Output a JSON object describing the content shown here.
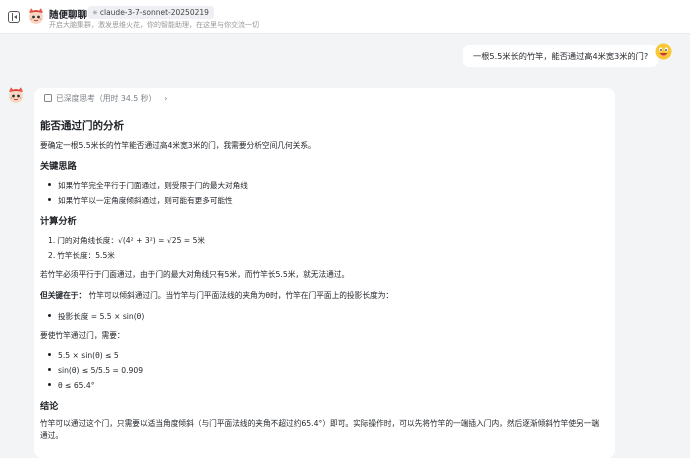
{
  "header": {
    "title": "随便聊聊",
    "model": "claude-3-7-sonnet-20250219",
    "subtitle": "开启大脑集群，激发思维火花，你的智能助理，在这里与你交流一切"
  },
  "conversation": {
    "user_message": "一根5.5米长的竹竿，能否通过高4米宽3米的门?",
    "thinking_label": "已深度思考（用时 34.5 秒）",
    "answer": {
      "h1": "能否通过门的分析",
      "intro": "要确定一根5.5米长的竹竿能否通过高4米宽3米的门，我需要分析空间几何关系。",
      "h2_idea": "关键思路",
      "idea_items": [
        "如果竹竿完全平行于门面通过，则受限于门的最大对角线",
        "如果竹竿以一定角度倾斜通过，则可能有更多可能性"
      ],
      "h2_calc": "计算分析",
      "calc_items": [
        {
          "num": "1.",
          "text": "门的对角线长度：√(4² + 3²) = √25 = 5米"
        },
        {
          "num": "2.",
          "text": "竹竿长度：5.5米"
        }
      ],
      "para_parallel": "若竹竿必须平行于门面通过，由于门的最大对角线只有5米，而竹竿长5.5米，就无法通过。",
      "para_key_bold": "但关键在于：",
      "para_key_rest": " 竹竿可以倾斜通过门。当竹竿与门平面法线的夹角为θ时，竹竿在门平面上的投影长度为：",
      "proj_item": "投影长度 = 5.5 × sin(θ)",
      "para_need": "要使竹竿通过门，需要：",
      "cond_items": [
        "5.5 × sin(θ) ≤ 5",
        "sin(θ) ≤ 5/5.5 = 0.909",
        "θ ≤ 65.4°"
      ],
      "h2_conclusion": "结论",
      "conclusion": "竹竿可以通过这个门，只需要以适当角度倾斜（与门平面法线的夹角不超过约65.4°）即可。实际操作时，可以先将竹竿的一端插入门内，然后逐渐倾斜竹竿使另一端通过。"
    }
  },
  "icons": {
    "sidebar": "sidebar-toggle-icon",
    "assistant": "cartoon-cat-avatar-icon",
    "user": "smiley-face-avatar-icon"
  },
  "colors": {
    "background": "#f3f4f6",
    "card": "#ffffff",
    "muted_text": "#999999"
  }
}
